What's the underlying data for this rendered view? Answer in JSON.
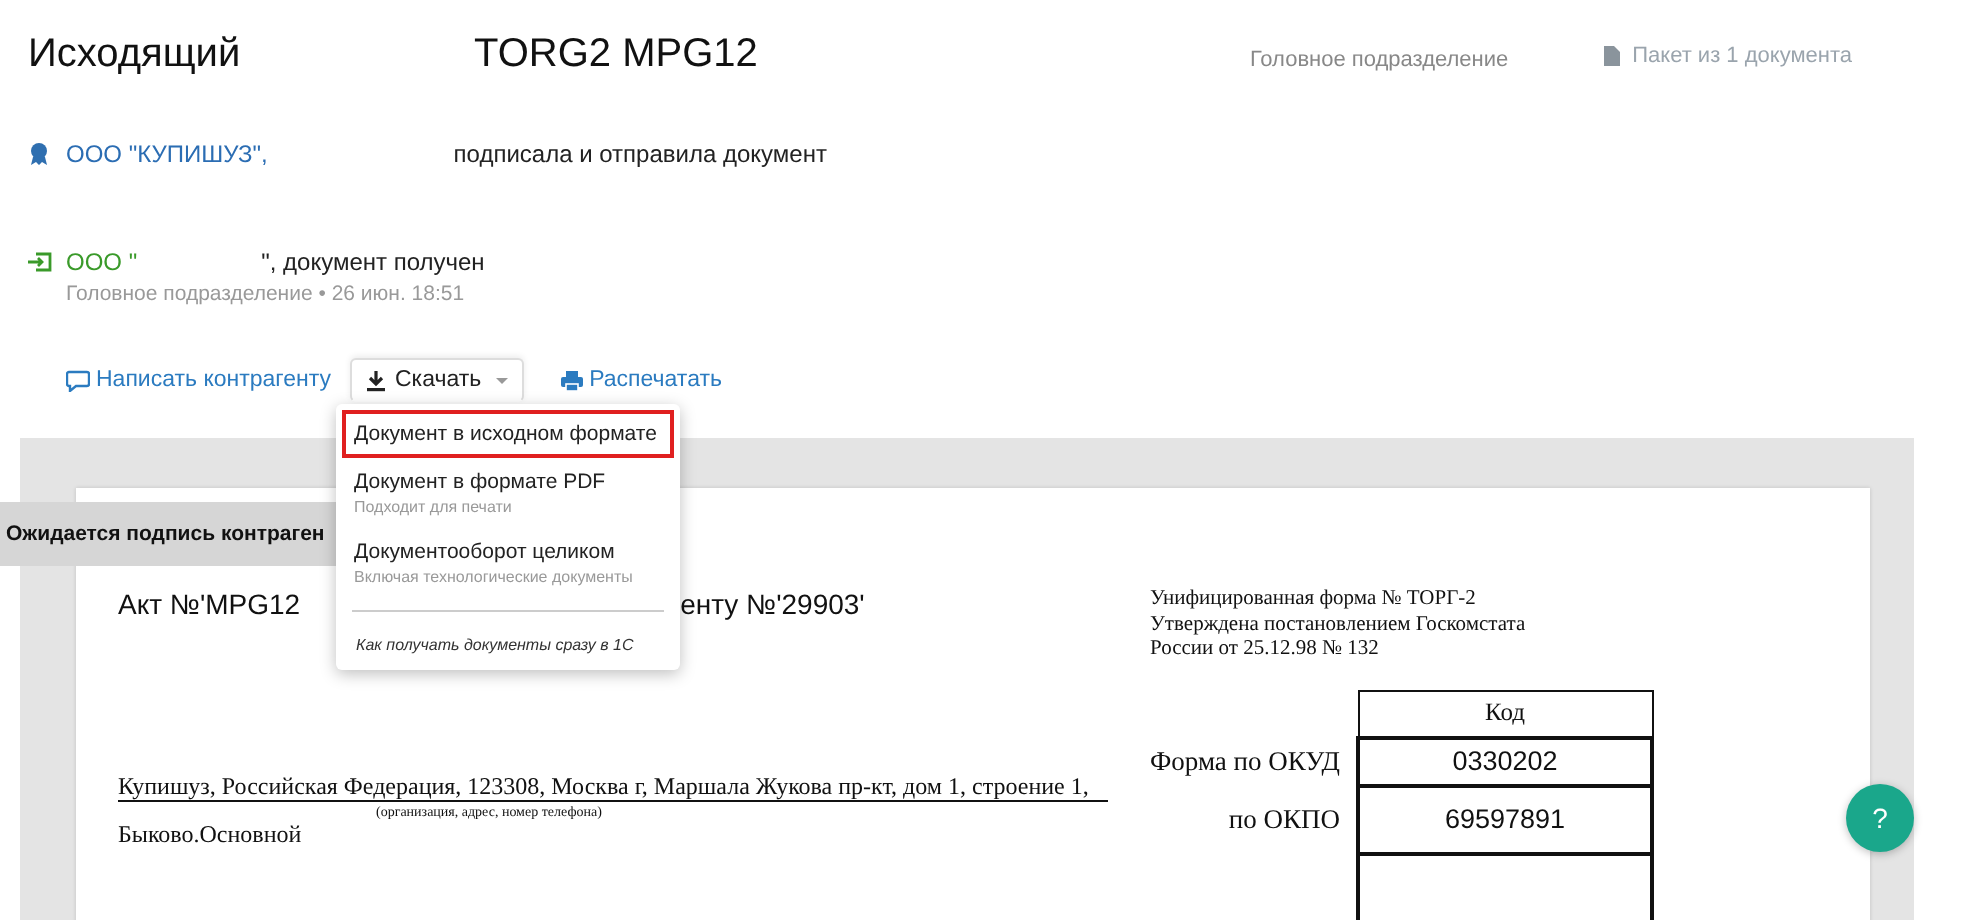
{
  "header": {
    "title": "Исходящий",
    "document_name": "TORG2 MPG12",
    "department": "Головное подразделение",
    "package": "Пакет из 1 документа"
  },
  "events": [
    {
      "kind": "sent",
      "organization": "ООО \"КУПИШУЗ\",",
      "action": "подписала и отправила документ"
    },
    {
      "kind": "received",
      "organization": "ООО \"",
      "action": "\", документ получен",
      "department": "Головное подразделение",
      "separator": "•",
      "time": "26 июн. 18:51"
    }
  ],
  "actions": [
    {
      "kind": "message",
      "label": "Написать контрагенту"
    },
    {
      "kind": "download",
      "label": "Скачать",
      "expanded": true
    },
    {
      "kind": "print",
      "label": "Распечатать"
    }
  ],
  "download_menu": {
    "items": [
      {
        "label": "Документ в исходном формате",
        "selected": true
      },
      {
        "label": "Документ в формате PDF",
        "hint": "Подходит для печати",
        "selected": false
      },
      {
        "label": "Документооборот целиком",
        "hint": "Включая технологические документы",
        "selected": false
      }
    ],
    "help_link": "Как получать документы сразу в 1С"
  },
  "document": {
    "status_banner": "Ожидается подпись контраген",
    "title_left": "Акт №'MPG12",
    "title_right": "енту №'29903'",
    "form_info": [
      "Унифицированная форма № ТОРГ-2",
      "Утверждена постановлением Госкомстата",
      "России от 25.12.98 № 132"
    ],
    "codes_heading": "Код",
    "codes": [
      {
        "label": "Форма по ОКУД",
        "value": "0330202"
      },
      {
        "label": "по ОКПО",
        "value": "69597891"
      }
    ],
    "organization": "Купишуз, Российская Федерация, 123308, Москва г, Маршала Жукова пр-кт, дом 1, строение 1,",
    "organization_caption": "(организация, адрес, номер телефона)",
    "division": "Быково.Основной"
  },
  "help_button": "?"
}
